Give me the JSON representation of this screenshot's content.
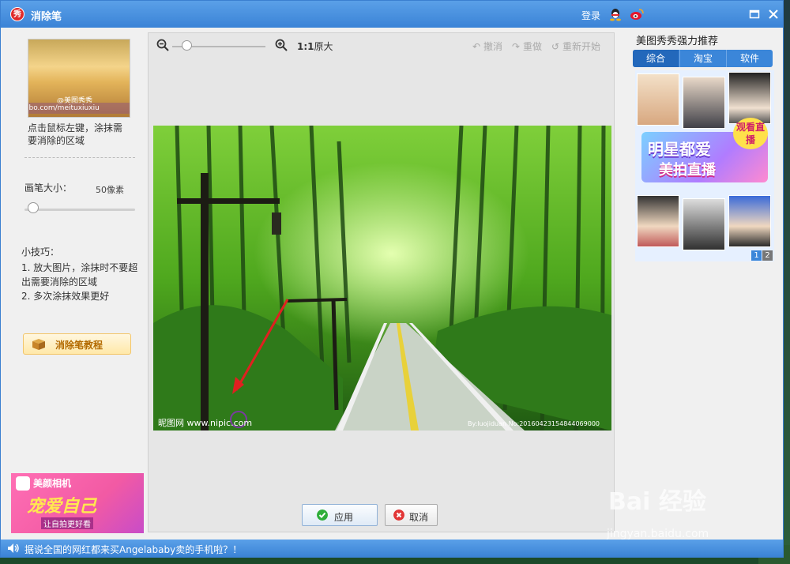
{
  "titlebar": {
    "app_icon_text": "秀",
    "title": "消除笔",
    "login": "登录"
  },
  "left": {
    "thumb_wm": "ibo.com/meituxiuxiu",
    "thumb_wm2": "@美图秀秀",
    "hint": "点击鼠标左键，涂抹需要消除的区域",
    "brush_label": "画笔大小：",
    "brush_value": "50像素",
    "brush_level": 0.08,
    "tips_title": "小技巧：",
    "tip1": "1. 放大图片，涂抹时不要超出需要消除的区域",
    "tip2": "2. 多次涂抹效果更好",
    "tutorial": "消除笔教程",
    "ad_brand": "美颜相机",
    "ad_slogan": "宠爱自己",
    "ad_sub": "让自拍更好看"
  },
  "center": {
    "ratio": "1:1",
    "ratio_text": "原大",
    "undo": "撤消",
    "redo": "重做",
    "reset": "重新开始",
    "photo_wm": "昵图网 www.nipic.com",
    "photo_id": "By:luojiduan No:20160423154844069000",
    "apply": "应用",
    "cancel": "取消"
  },
  "right": {
    "title": "美图秀秀强力推荐",
    "tabs": [
      "综合",
      "淘宝",
      "软件"
    ],
    "banner_line1": "明星都爱",
    "banner_line2": "美拍直播",
    "live_badge": "观看直播",
    "pages": [
      "1",
      "2"
    ]
  },
  "footer": {
    "news": "据说全国的网红都来买Angelababy卖的手机啦？！"
  },
  "watermark": {
    "logo": "Bai 经验",
    "sub": "jingyan.baidu.com"
  },
  "colors": {
    "titlebar": "#3b83d6",
    "accent": "#2368bb",
    "tutorial": "#b36a00"
  }
}
